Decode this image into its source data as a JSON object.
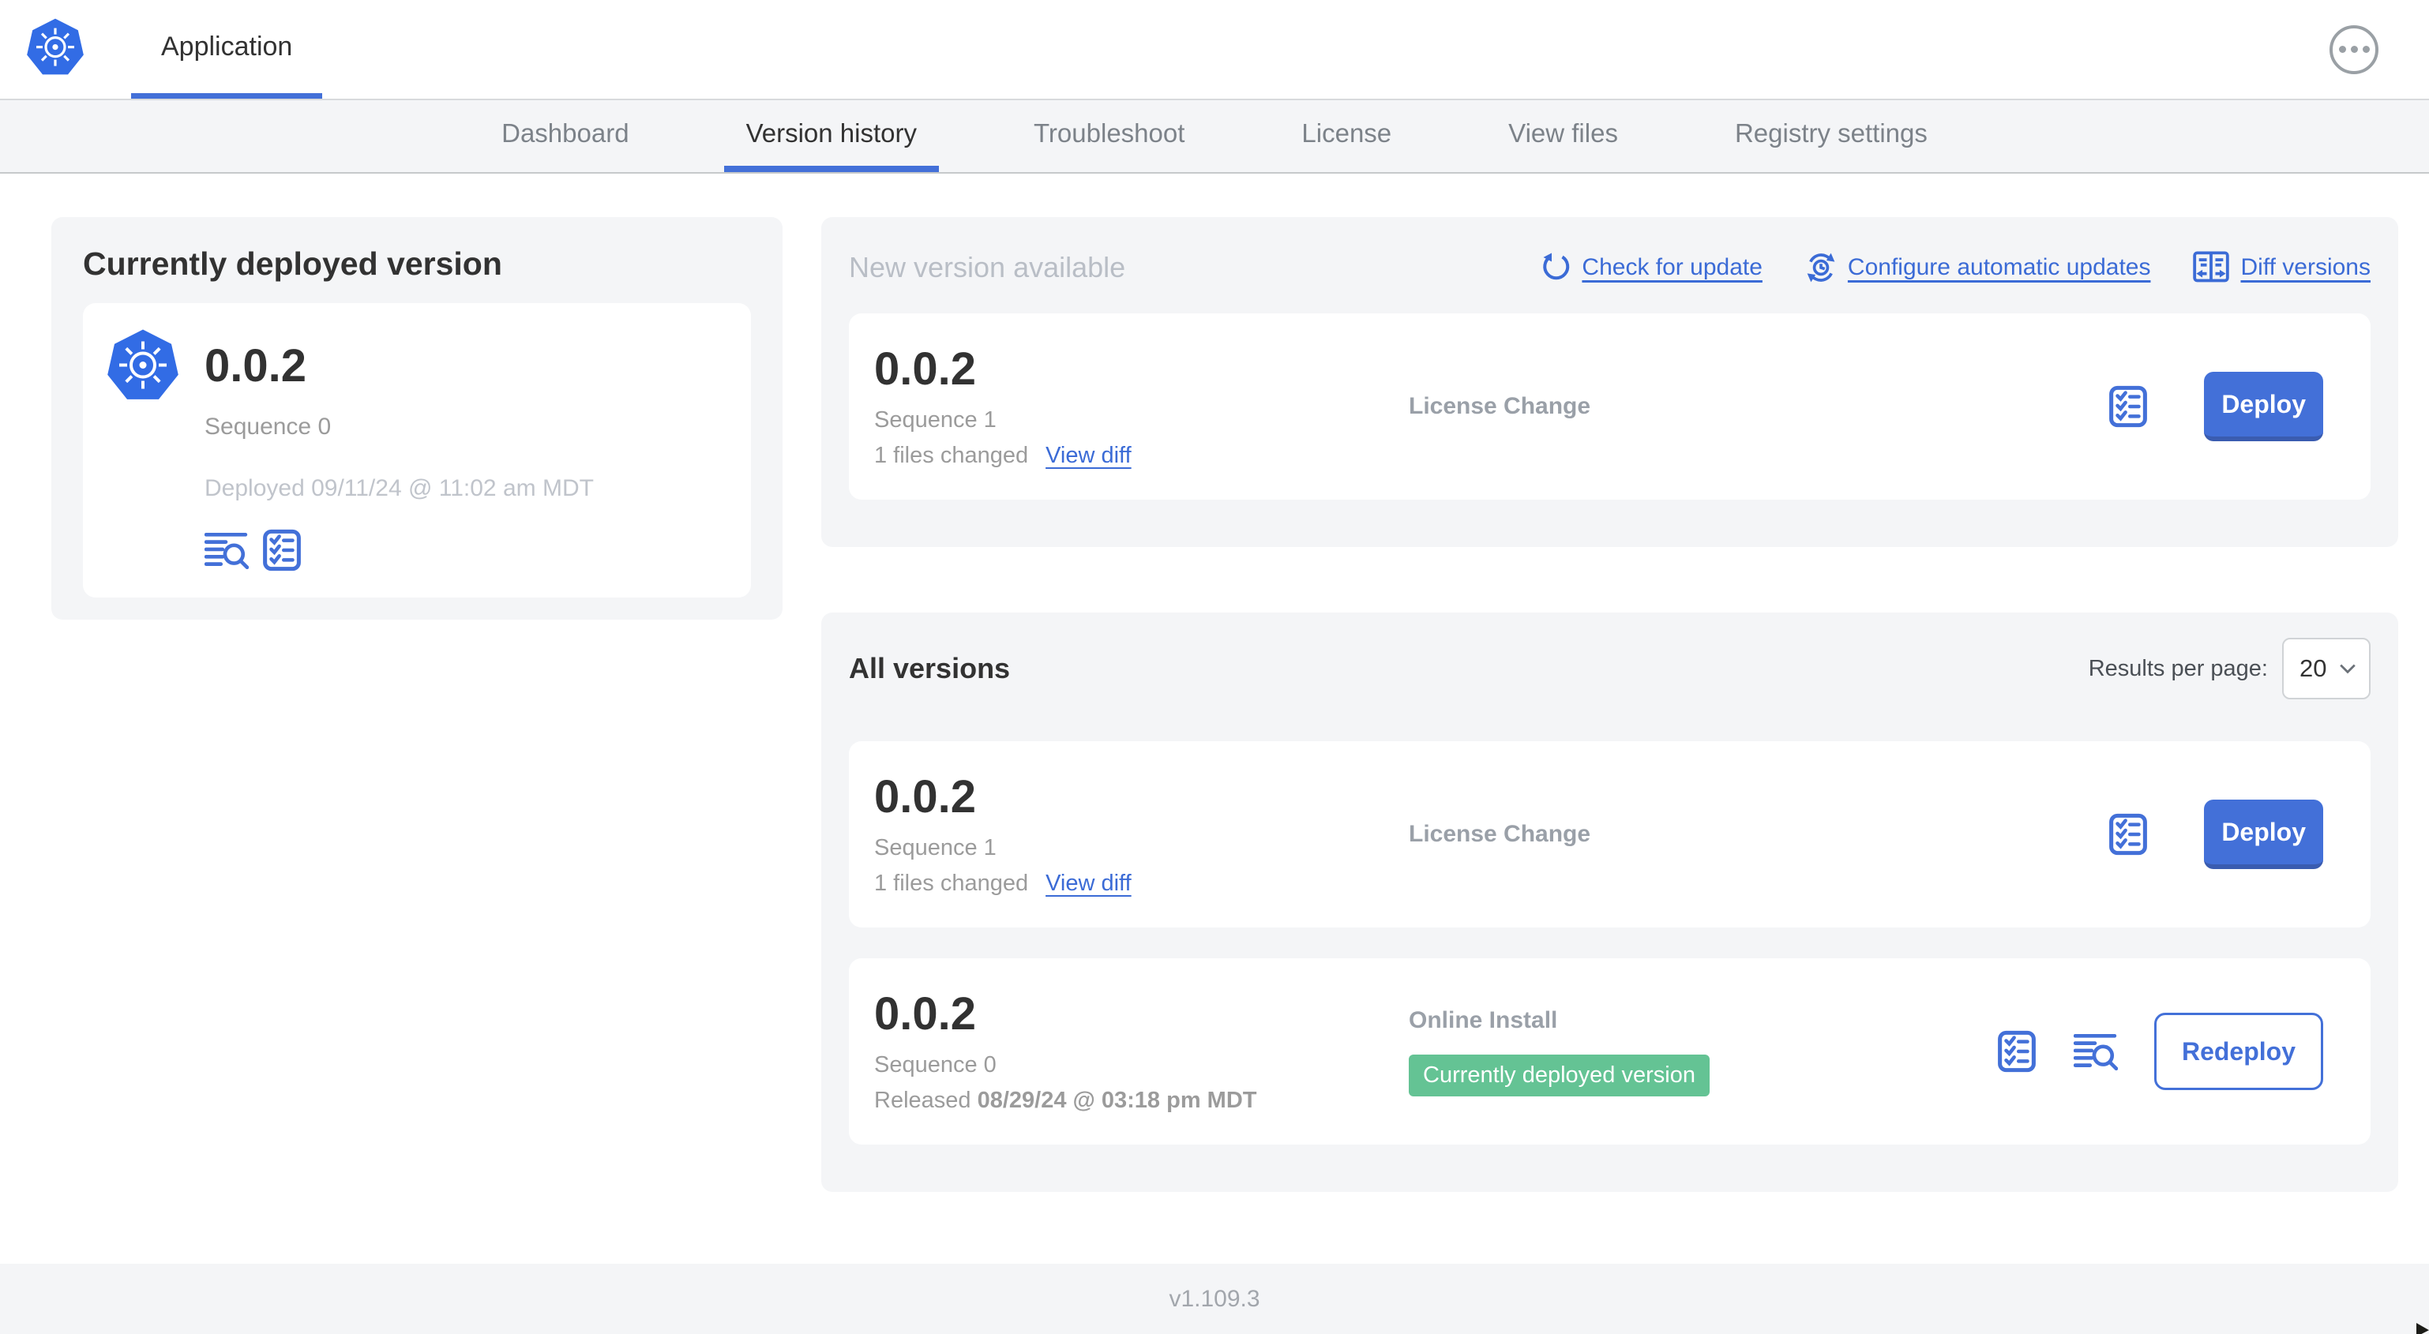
{
  "colors": {
    "accent_blue": "#4370d8",
    "link_blue": "#3b6bd6",
    "logo_blue": "#326ce5",
    "badge_green": "#64c394",
    "card_bg": "#f4f5f7",
    "text_dark": "#323232",
    "text_gray": "#9b9b9b",
    "text_light_gray": "#c0c4cb"
  },
  "header": {
    "app_tab": "Application",
    "logo_icon": "kubernetes-logo",
    "menu_icon": "ellipsis-icon"
  },
  "nav": {
    "tabs": [
      {
        "label": "Dashboard",
        "active": false
      },
      {
        "label": "Version history",
        "active": true
      },
      {
        "label": "Troubleshoot",
        "active": false
      },
      {
        "label": "License",
        "active": false
      },
      {
        "label": "View files",
        "active": false
      },
      {
        "label": "Registry settings",
        "active": false
      }
    ]
  },
  "current_version": {
    "title": "Currently deployed version",
    "version": "0.0.2",
    "sequence": "Sequence 0",
    "deployed": "Deployed 09/11/24 @ 11:02 am MDT",
    "icons": [
      "view-logs-icon",
      "preflight-checks-icon"
    ]
  },
  "new_version": {
    "title": "New version available",
    "actions": {
      "check": "Check for update",
      "configure": "Configure automatic updates",
      "diff": "Diff versions"
    },
    "row": {
      "version": "0.0.2",
      "sequence": "Sequence 1",
      "files_changed": "1 files changed",
      "view_diff": "View diff",
      "source": "License Change",
      "deploy_label": "Deploy"
    }
  },
  "all_versions": {
    "title": "All versions",
    "results_per_page_label": "Results per page:",
    "results_per_page_value": "20",
    "rows": [
      {
        "version": "0.0.2",
        "sequence": "Sequence 1",
        "files_changed": "1 files changed",
        "view_diff": "View diff",
        "source": "License Change",
        "action_label": "Deploy"
      },
      {
        "version": "0.0.2",
        "sequence": "Sequence 0",
        "released_prefix": "Released",
        "released_date": "08/29/24 @ 03:18 pm MDT",
        "source": "Online Install",
        "badge": "Currently deployed version",
        "action_label": "Redeploy"
      }
    ]
  },
  "footer": {
    "app_version": "v1.109.3"
  }
}
